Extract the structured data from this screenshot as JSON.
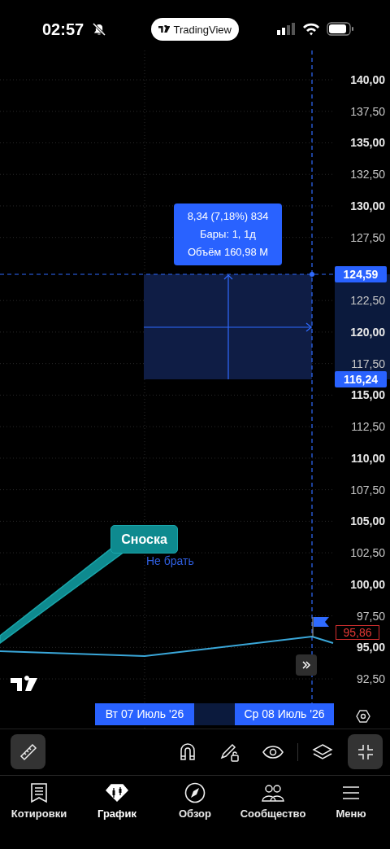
{
  "status_bar": {
    "time": "02:57",
    "app_badge": "TradingView"
  },
  "chart": {
    "price_axis": [
      {
        "label": "140,00",
        "major": true
      },
      {
        "label": "137,50",
        "major": false
      },
      {
        "label": "135,00",
        "major": true
      },
      {
        "label": "132,50",
        "major": false
      },
      {
        "label": "130,00",
        "major": true
      },
      {
        "label": "127,50",
        "major": false
      },
      {
        "label": "122,50",
        "major": false
      },
      {
        "label": "120,00",
        "major": true
      },
      {
        "label": "117,50",
        "major": false
      },
      {
        "label": "115,00",
        "major": true
      },
      {
        "label": "112,50",
        "major": false
      },
      {
        "label": "110,00",
        "major": true
      },
      {
        "label": "107,50",
        "major": false
      },
      {
        "label": "105,00",
        "major": true
      },
      {
        "label": "102,50",
        "major": false
      },
      {
        "label": "100,00",
        "major": true
      },
      {
        "label": "97,50",
        "major": false
      },
      {
        "label": "95,00",
        "major": true
      },
      {
        "label": "92,50",
        "major": false
      }
    ],
    "measure_tooltip": [
      "8,34 (7,18%) 834",
      "Бары: 1, 1д",
      "Объём 160,98 M"
    ],
    "crosshair_price": "124,59",
    "measure_low_price": "116,24",
    "last_price": "95,86",
    "callout": "Сноска",
    "note": "Не брать",
    "date_labels": [
      "Вт 07 Июль '26",
      "Ср 08 Июль '26"
    ]
  },
  "drawing_toolbar": [
    {
      "kind": "ruler",
      "selected": true
    },
    {
      "kind": "magnet",
      "selected": false
    },
    {
      "kind": "lock",
      "selected": false
    },
    {
      "kind": "eye",
      "selected": false
    },
    {
      "kind": "layers",
      "selected": false
    },
    {
      "kind": "collapse",
      "selected": true
    }
  ],
  "tabs": [
    {
      "kind": "quotes",
      "label": "Котировки",
      "selected": false
    },
    {
      "kind": "chart",
      "label": "График",
      "selected": true
    },
    {
      "kind": "explore",
      "label": "Обзор",
      "selected": false
    },
    {
      "kind": "community",
      "label": "Сообщество",
      "selected": false
    },
    {
      "kind": "menu",
      "label": "Меню",
      "selected": false
    }
  ]
}
